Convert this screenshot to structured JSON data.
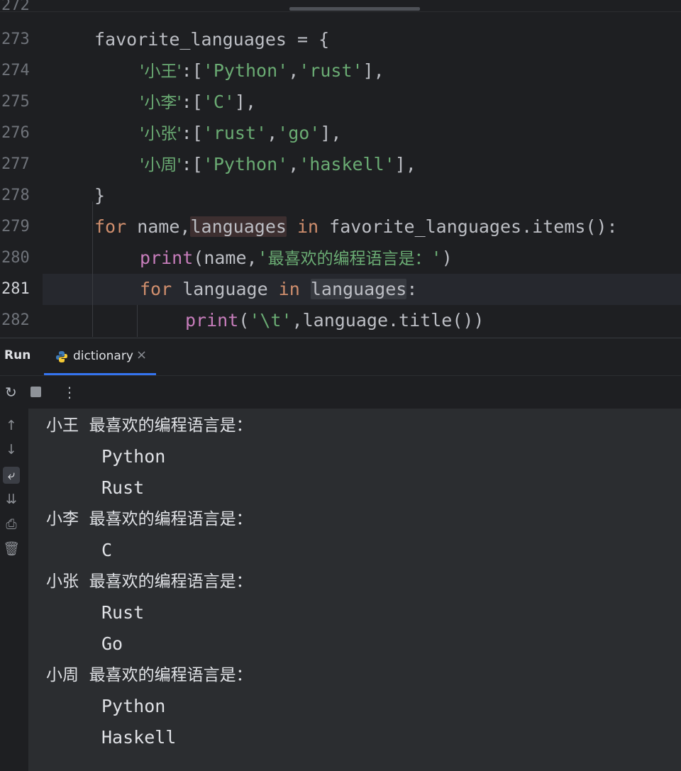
{
  "editor": {
    "line_numbers": [
      "272",
      "273",
      "274",
      "275",
      "276",
      "277",
      "278",
      "279",
      "280",
      "281",
      "282"
    ],
    "current_line": "281",
    "code": {
      "l273": {
        "var": "favorite_languages",
        "rest": " = {"
      },
      "l274": {
        "key": "'小王'",
        "p1": ":[",
        "s1": "'Python'",
        "p2": ",",
        "s2": "'rust'",
        "p3": "],"
      },
      "l275": {
        "key": "'小李'",
        "p1": ":[",
        "s1": "'C'",
        "p3": "],"
      },
      "l276": {
        "key": "'小张'",
        "p1": ":[",
        "s1": "'rust'",
        "p2": ",",
        "s2": "'go'",
        "p3": "],"
      },
      "l277": {
        "key": "'小周'",
        "p1": ":[",
        "s1": "'Python'",
        "p2": ",",
        "s2": "'haskell'",
        "p3": "],"
      },
      "l278": {
        "text": "}"
      },
      "l279": {
        "kw1": "for",
        "t1": " name,",
        "hl": "languages",
        "sp": " ",
        "kw2": "in",
        "t2": " favorite_languages.items():"
      },
      "l280": {
        "fn": "print",
        "t1": "(name,",
        "str_open": "'",
        "str_cn": "最喜欢的编程语言是：",
        "str_close": "'",
        "t2": ")"
      },
      "l281": {
        "kw1": "for",
        "t1": " language ",
        "kw2": "in",
        "sp": " ",
        "hl": "languages",
        "t2": ":"
      },
      "l282": {
        "fn": "print",
        "t1": "(",
        "str": "'\\t'",
        "t2": ",language.title())"
      }
    }
  },
  "run_panel": {
    "title": "Run",
    "tab_label": "dictionary",
    "tab_close": "×",
    "toolbar": {
      "rerun": "↻",
      "more": "⋮"
    },
    "sidebar": {
      "up": "↑",
      "down": "↓",
      "wrap": "⤶",
      "scroll_end": "⇊",
      "print": "⎙",
      "trash": "🗑"
    }
  },
  "output": [
    {
      "name": "小王",
      "label": "最喜欢的编程语言是：",
      "langs": [
        "Python",
        "Rust"
      ]
    },
    {
      "name": "小李",
      "label": "最喜欢的编程语言是：",
      "langs": [
        "C"
      ]
    },
    {
      "name": "小张",
      "label": "最喜欢的编程语言是：",
      "langs": [
        "Rust",
        "Go"
      ]
    },
    {
      "name": "小周",
      "label": "最喜欢的编程语言是：",
      "langs": [
        "Python",
        "Haskell"
      ]
    }
  ],
  "colors": {
    "keyword": "#cf8e6d",
    "string": "#6aab73",
    "builtin": "#c77dbb",
    "accent": "#3574f0"
  }
}
